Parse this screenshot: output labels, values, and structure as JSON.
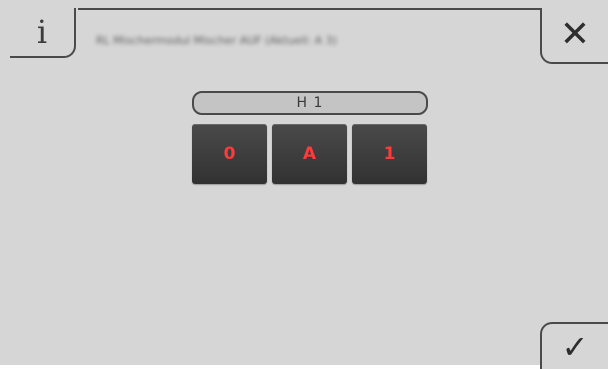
{
  "header": {
    "info_icon": "info-icon",
    "info_glyph": "ⅰ",
    "title": "RL Mischermodul Mischer AUF (Aktuell: A 3)",
    "close_icon": "close-icon",
    "close_glyph": "✕"
  },
  "editor": {
    "label": "H 1",
    "digits": [
      "0",
      "A",
      "1"
    ],
    "digit_color": "#ff3a3a"
  },
  "footer": {
    "confirm_icon": "checkmark-icon",
    "confirm_glyph": "✓"
  }
}
